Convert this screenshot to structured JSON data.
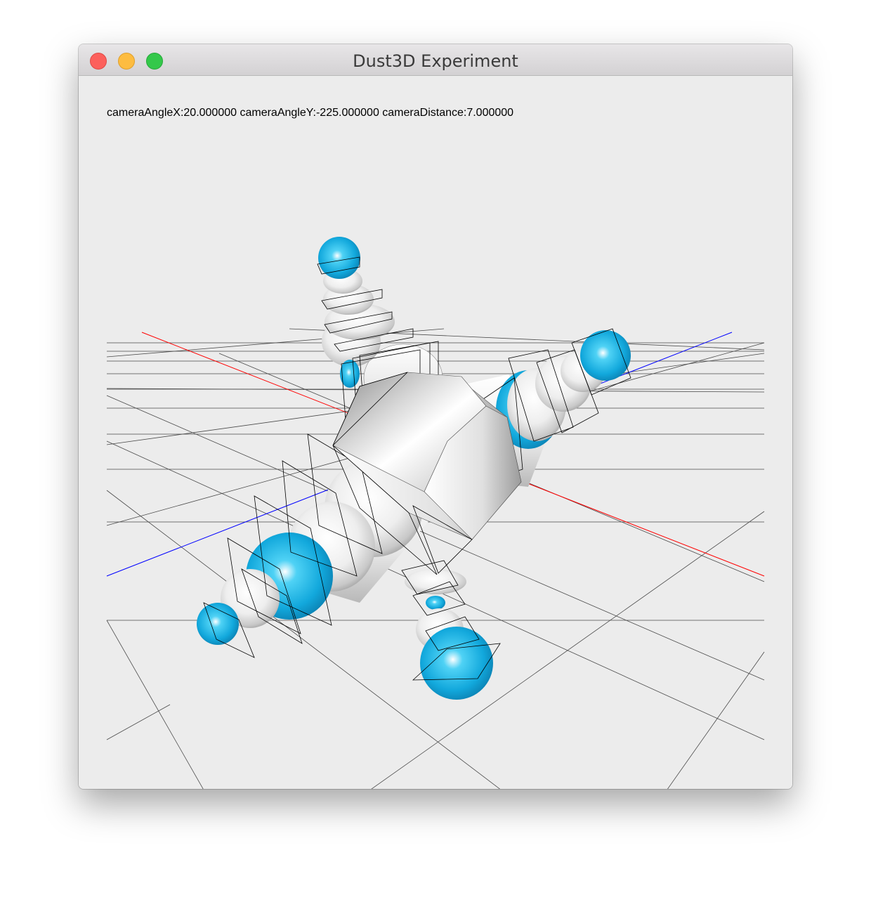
{
  "window": {
    "title": "Dust3D Experiment"
  },
  "viewport": {
    "camera_info": "cameraAngleX:20.000000 cameraAngleY:-225.000000 cameraDistance:7.000000",
    "colors": {
      "background": "#ececec",
      "grid": "#4a4a4a",
      "x_axis": "#ff0000",
      "z_axis": "#0000ff",
      "mesh_white": "#f2f2f2",
      "joint_cyan": "#1eb4e6",
      "outline": "#000000"
    },
    "icons": [
      "close-icon",
      "minimize-icon",
      "zoom-icon"
    ]
  }
}
